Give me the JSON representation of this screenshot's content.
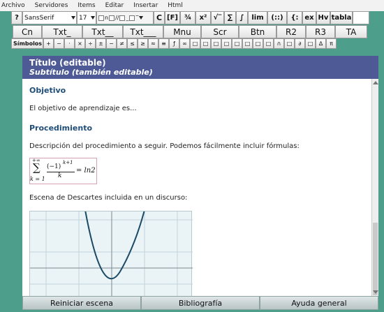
{
  "menubar": {
    "items": [
      "Archivo",
      "Servidores",
      "Items",
      "Editar",
      "Insertar",
      "Html"
    ]
  },
  "toolbar": {
    "help": "?",
    "font_family": "SansSerif",
    "font_size": "17",
    "style_n": "n",
    "style_c": "C",
    "row1_buttons": [
      "[F]",
      "¾",
      "x²",
      "√‾",
      "∑",
      "∫",
      "lim",
      "(::)",
      "{:",
      "ex",
      "Hv",
      "tabla"
    ],
    "row2_buttons": [
      "Cn",
      "Txt_",
      "Txt__",
      "Txt___",
      "Mnu",
      "Scr",
      "Btn",
      "R2",
      "R3",
      "TA"
    ],
    "symbols_label": "Símbolos",
    "symbols": [
      "+",
      "−",
      "·",
      "×",
      "÷",
      "±",
      "−",
      "≠",
      "≤",
      "≥",
      "≈",
      "≡",
      "ƒ",
      "∞",
      "□",
      "□",
      "□",
      "□",
      "□",
      "□",
      "□",
      "□",
      "∩",
      "□",
      "∂",
      "□",
      "∆",
      "π"
    ]
  },
  "document": {
    "title": "Título (editable)",
    "subtitle": "Subtítulo (también editable)",
    "section1_heading": "Objetivo",
    "section1_text": "El objetivo de aprendizaje es...",
    "section2_heading": "Procedimiento",
    "section2_text": "Descripción del procedimiento a seguir. Podemos fácilmente incluir fórmulas:",
    "formula": {
      "upper": "+∞",
      "sigma": "∑",
      "lower": "k = 1",
      "numerator": "(−1)",
      "exponent": "k+1",
      "denominator": "k",
      "rhs": "= ln2"
    },
    "scene_text": "Escena de Descartes incluida en un discurso:"
  },
  "bottombar": {
    "reset": "Reiniciar escena",
    "biblio": "Bibliografía",
    "help": "Ayuda general"
  }
}
